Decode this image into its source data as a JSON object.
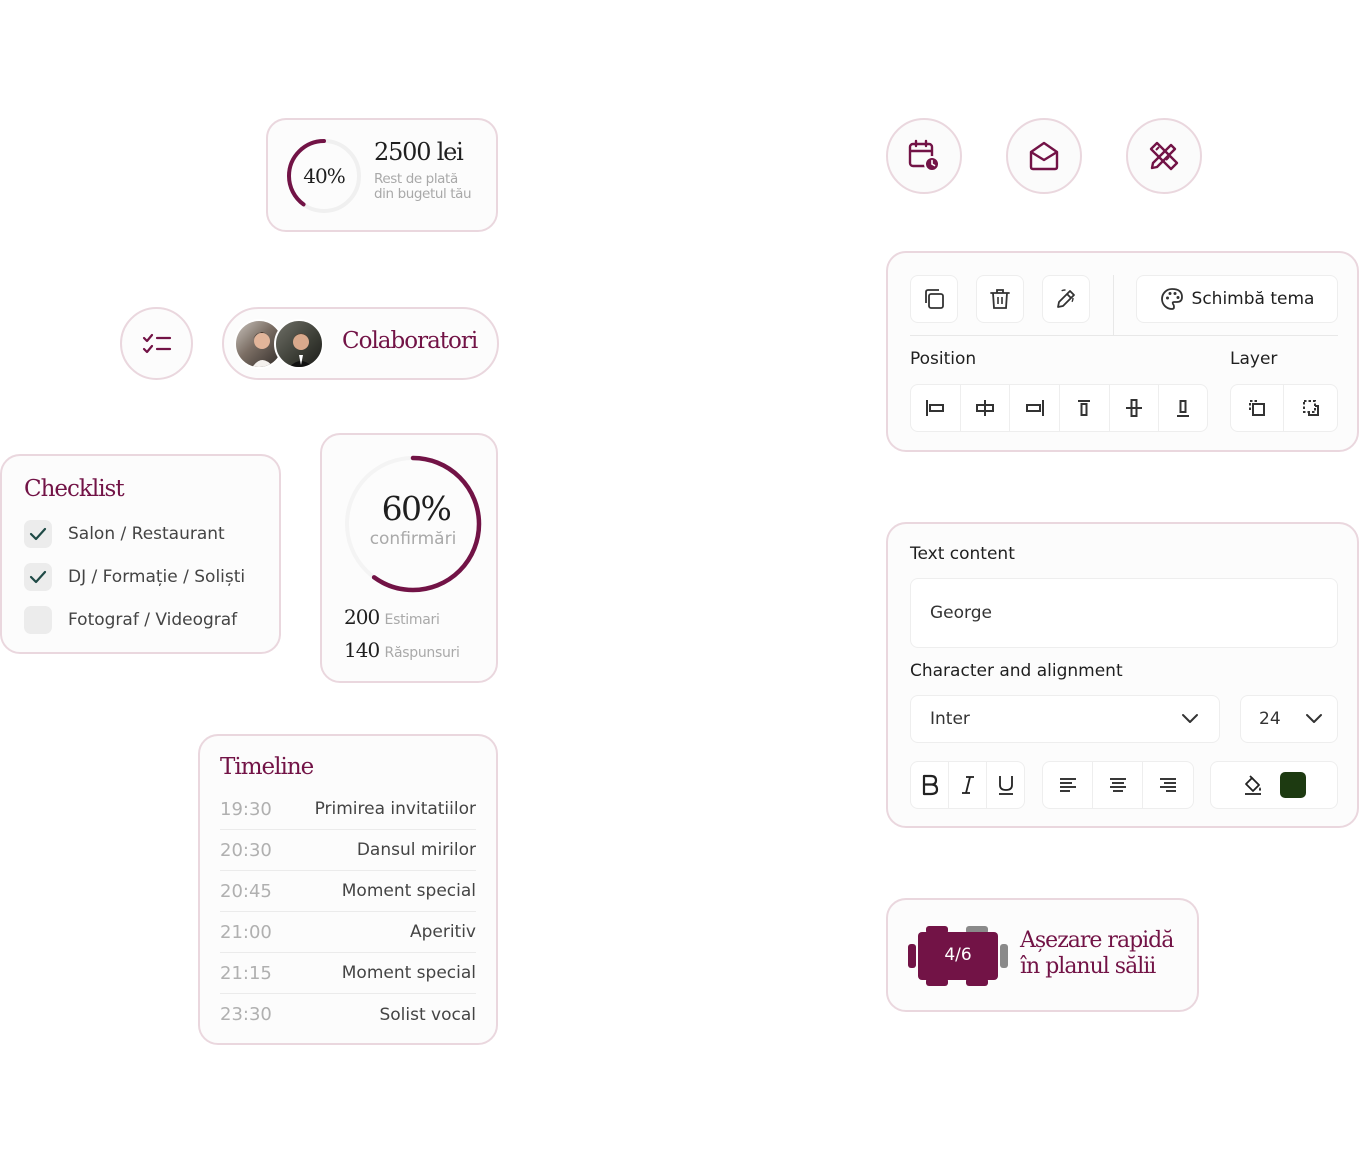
{
  "budget": {
    "percent": "40%",
    "percent_value": 0.4,
    "amount": "2500 lei",
    "line1": "Rest de plată",
    "line2": "din bugetul tău"
  },
  "collaborators": {
    "label": "Colaboratori"
  },
  "checklist": {
    "title": "Checklist",
    "items": [
      {
        "label": "Salon / Restaurant",
        "checked": true
      },
      {
        "label": "DJ / Formație / Soliști",
        "checked": true
      },
      {
        "label": "Fotograf / Videograf",
        "checked": false
      }
    ]
  },
  "confirmations": {
    "percent": "60%",
    "percent_value": 0.6,
    "label": "confirmări",
    "estimated_value": "200",
    "estimated_label": "Estimari",
    "responses_value": "140",
    "responses_label": "Răspunsuri"
  },
  "timeline": {
    "title": "Timeline",
    "rows": [
      {
        "time": "19:30",
        "event": "Primirea invitatiilor"
      },
      {
        "time": "20:30",
        "event": "Dansul mirilor"
      },
      {
        "time": "20:45",
        "event": "Moment special"
      },
      {
        "time": "21:00",
        "event": "Aperitiv"
      },
      {
        "time": "21:15",
        "event": "Moment special"
      },
      {
        "time": "23:30",
        "event": "Solist vocal"
      }
    ]
  },
  "toolbar": {
    "theme_label": "Schimbă tema",
    "position_label": "Position",
    "layer_label": "Layer"
  },
  "text_panel": {
    "content_label": "Text content",
    "content_value": "George",
    "char_label": "Character and alignment",
    "font": "Inter",
    "size": "24"
  },
  "seating": {
    "table_label": "4/6",
    "line1": "Așezare rapidă",
    "line2": "în planul sălii"
  },
  "colors": {
    "accent": "#721346",
    "border": "#ead7de",
    "check": "#1f4a46",
    "swatch": "#1d3a11"
  }
}
